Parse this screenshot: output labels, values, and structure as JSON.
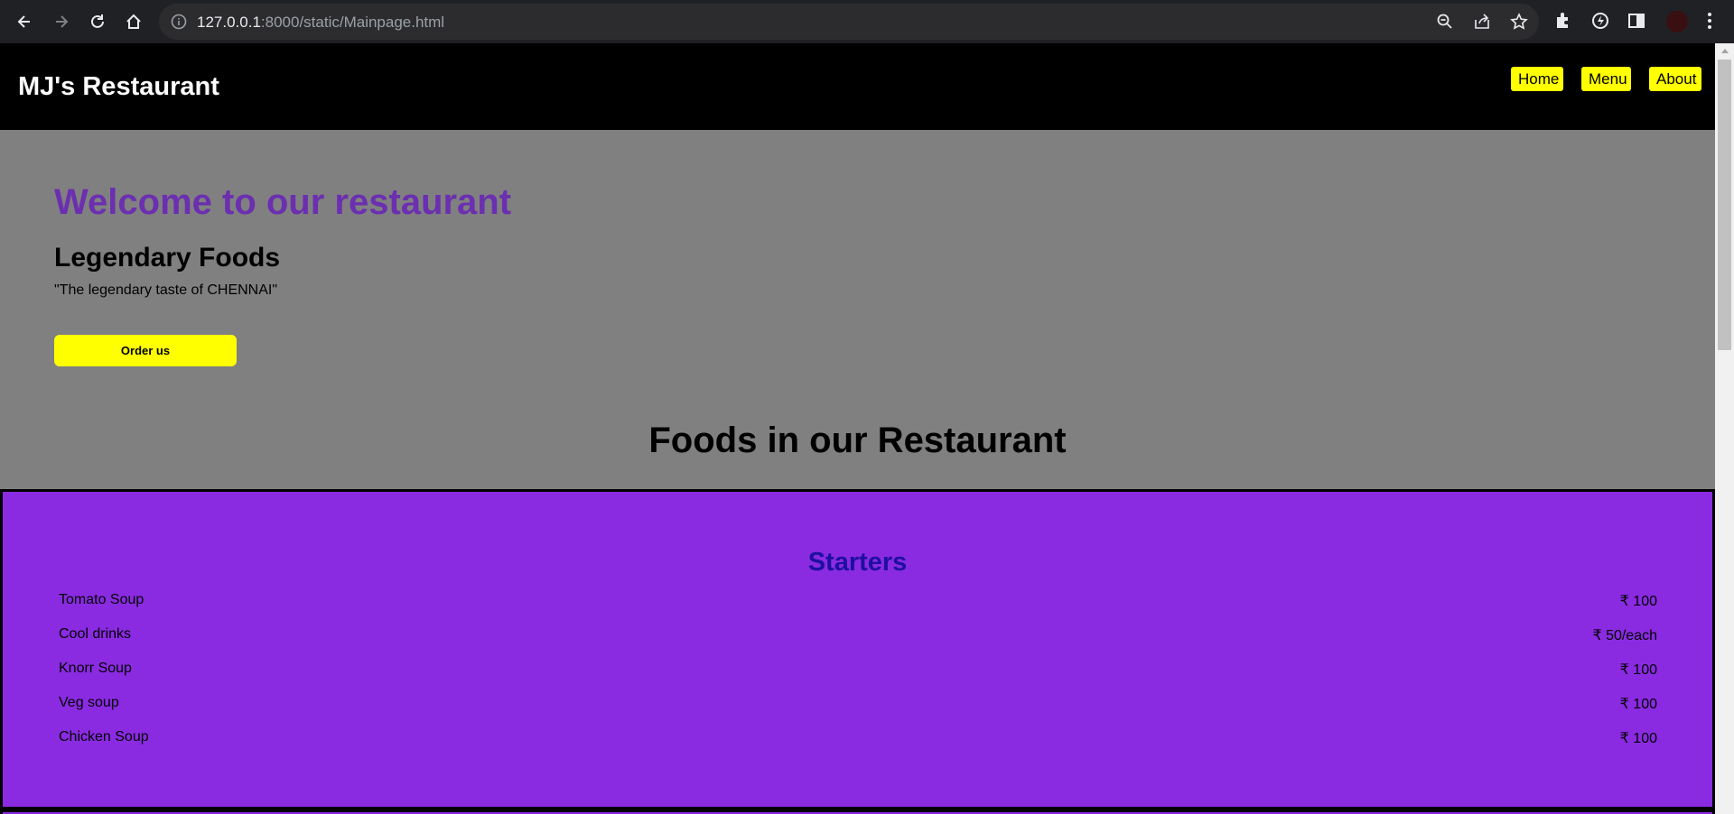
{
  "browser": {
    "url_host": "127.0.0.1",
    "url_rest": ":8000/static/Mainpage.html"
  },
  "header": {
    "brand": "MJ's Restaurant",
    "nav": [
      "Home",
      "Menu",
      "About"
    ]
  },
  "hero": {
    "title": "Welcome to our restaurant",
    "subtitle": "Legendary Foods",
    "quote": "\"The legendary taste of CHENNAI\"",
    "button": "Order us"
  },
  "foods": {
    "title": "Foods in our Restaurant"
  },
  "starters": {
    "heading": "Starters",
    "items": [
      {
        "name": "Tomato Soup",
        "price": "₹ 100"
      },
      {
        "name": "Cool drinks",
        "price": "₹ 50/each"
      },
      {
        "name": "Knorr Soup",
        "price": "₹ 100"
      },
      {
        "name": "Veg soup",
        "price": "₹ 100"
      },
      {
        "name": "Chicken Soup",
        "price": "₹ 100"
      }
    ]
  },
  "colors": {
    "header_bg": "#000000",
    "nav_bg": "#ffff00",
    "page_bg": "#808080",
    "hero_title": "#6b2fb0",
    "menu_bg": "#8a2be2",
    "menu_heading": "#1e0fa0"
  }
}
